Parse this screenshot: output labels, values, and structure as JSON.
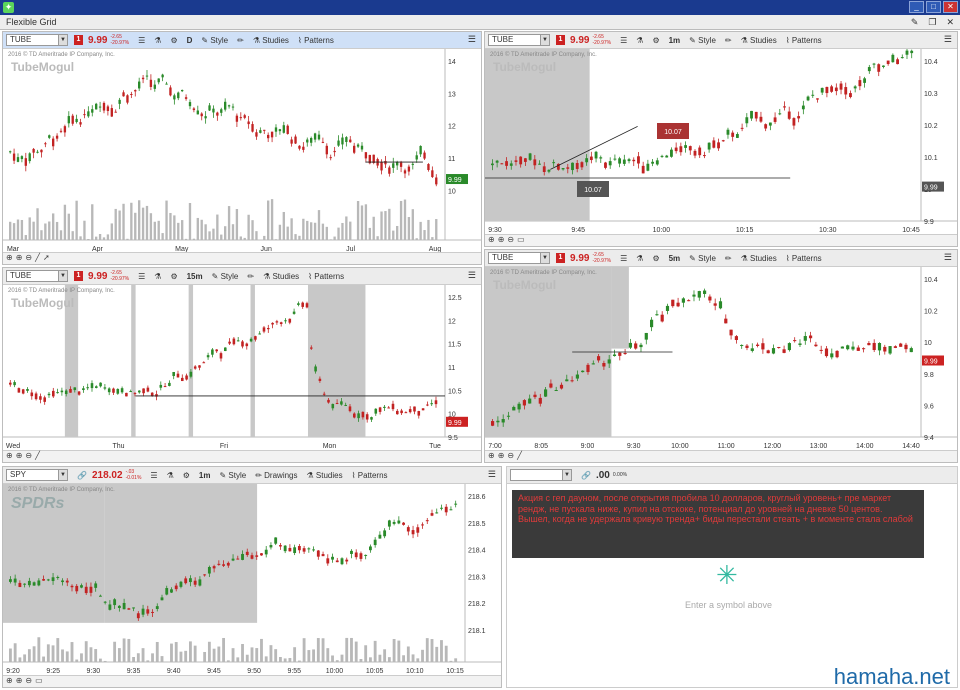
{
  "window": {
    "minimize": "_",
    "maximize": "□",
    "close": "✕"
  },
  "toolbar": {
    "grid_name": "Flexible Grid",
    "icons": [
      "pin-icon",
      "maximize-icon",
      "close-icon"
    ]
  },
  "panels": [
    {
      "symbol": "TUBE",
      "flag": "1",
      "price": "9.99",
      "chg1": "-2.65",
      "chg2": "-20.97%",
      "agg": "D",
      "style": "Style",
      "studies": "Studies",
      "patterns": "Patterns",
      "copyright": "2016 © TD Ameritrade IP Company, Inc.",
      "logo": "TubeMogul",
      "last": "9.99",
      "y_ticks": [
        "14",
        "13",
        "12",
        "11",
        "10"
      ],
      "x_ticks": [
        "Mar",
        "Apr",
        "May",
        "Jun",
        "Jul",
        "Aug"
      ],
      "vol_ticks": [
        "1.5",
        "1",
        "0.5",
        "0"
      ],
      "vol_label": "<millions>"
    },
    {
      "symbol": "TUBE",
      "flag": "1",
      "price": "9.99",
      "chg1": "-2.65",
      "chg2": "-20.97%",
      "agg": "1m",
      "style": "Style",
      "studies": "Studies",
      "patterns": "Patterns",
      "copyright": "2016 © TD Ameritrade IP Company, Inc.",
      "logo": "TubeMogul",
      "last": "9.99",
      "y_ticks": [
        "10.4",
        "10.3",
        "10.2",
        "10.1",
        "10",
        "9.9"
      ],
      "x_ticks": [
        "9:30",
        "9:45",
        "10:00",
        "10:15",
        "10:30",
        "10:45"
      ],
      "callout1": "10.07",
      "callout2": "10.07"
    },
    {
      "symbol": "TUBE",
      "flag": "1",
      "price": "9.99",
      "chg1": "-2.65",
      "chg2": "-20.97%",
      "agg": "15m",
      "style": "Style",
      "studies": "Studies",
      "patterns": "Patterns",
      "copyright": "2016 © TD Ameritrade IP Company, Inc.",
      "logo": "TubeMogul",
      "last": "9.99",
      "y_ticks": [
        "12.5",
        "12",
        "11.5",
        "11",
        "10.5",
        "10",
        "9.5"
      ],
      "x_ticks": [
        "Wed",
        "Thu",
        "Fri",
        "Mon",
        "Tue"
      ]
    },
    {
      "symbol": "TUBE",
      "flag": "1",
      "price": "9.99",
      "chg1": "-2.65",
      "chg2": "-20.97%",
      "agg": "5m",
      "style": "Style",
      "studies": "Studies",
      "patterns": "Patterns",
      "copyright": "2016 © TD Ameritrade IP Company, Inc.",
      "logo": "TubeMogul",
      "last": "9.99",
      "y_ticks": [
        "10.4",
        "10.2",
        "10",
        "9.8",
        "9.6",
        "9.4"
      ],
      "x_ticks": [
        "7:00",
        "8:05",
        "9:00",
        "9:30",
        "10:00",
        "11:00",
        "12:00",
        "13:00",
        "14:00",
        "14:40"
      ]
    },
    {
      "symbol": "SPY",
      "flag": "",
      "price": "218.02",
      "chg1": "-.03",
      "chg2": "-0.01%",
      "agg": "1m",
      "style": "Style",
      "drawings": "Drawings",
      "studies": "Studies",
      "patterns": "Patterns",
      "copyright": "2016 © TD Ameritrade IP Company, Inc.",
      "logo": "SPDRs",
      "y_ticks": [
        "218.6",
        "218.5",
        "218.4",
        "218.3",
        "218.2",
        "218.1"
      ],
      "x_ticks": [
        "9:20",
        "9:25",
        "9:30",
        "9:35",
        "9:40",
        "9:45",
        "9:50",
        "9:55",
        "10:00",
        "10:05",
        "10:10",
        "10:15"
      ]
    },
    {
      "symbol": "",
      "price": ".00",
      "chg2": "0.00%",
      "placeholder": "Enter a symbol above"
    }
  ],
  "note": "Акция с геп дауном, после открытия пробила 10 долларов, круглый уровень+ пре маркет рендж, не пускала ниже, купил на отскоке, потенциал до уровней на дневке 50 центов.\nВышел, когда не удержала кривую тренда+ биды перестали стеать + в моменте стала слабой",
  "watermark": "hamaha.net",
  "colors": {
    "up": "#2a8a2a",
    "down": "#c22222",
    "shade": "#c8c8c8",
    "titlebar": "#1a3a8f",
    "accent_panel": "#cfe0f7"
  }
}
